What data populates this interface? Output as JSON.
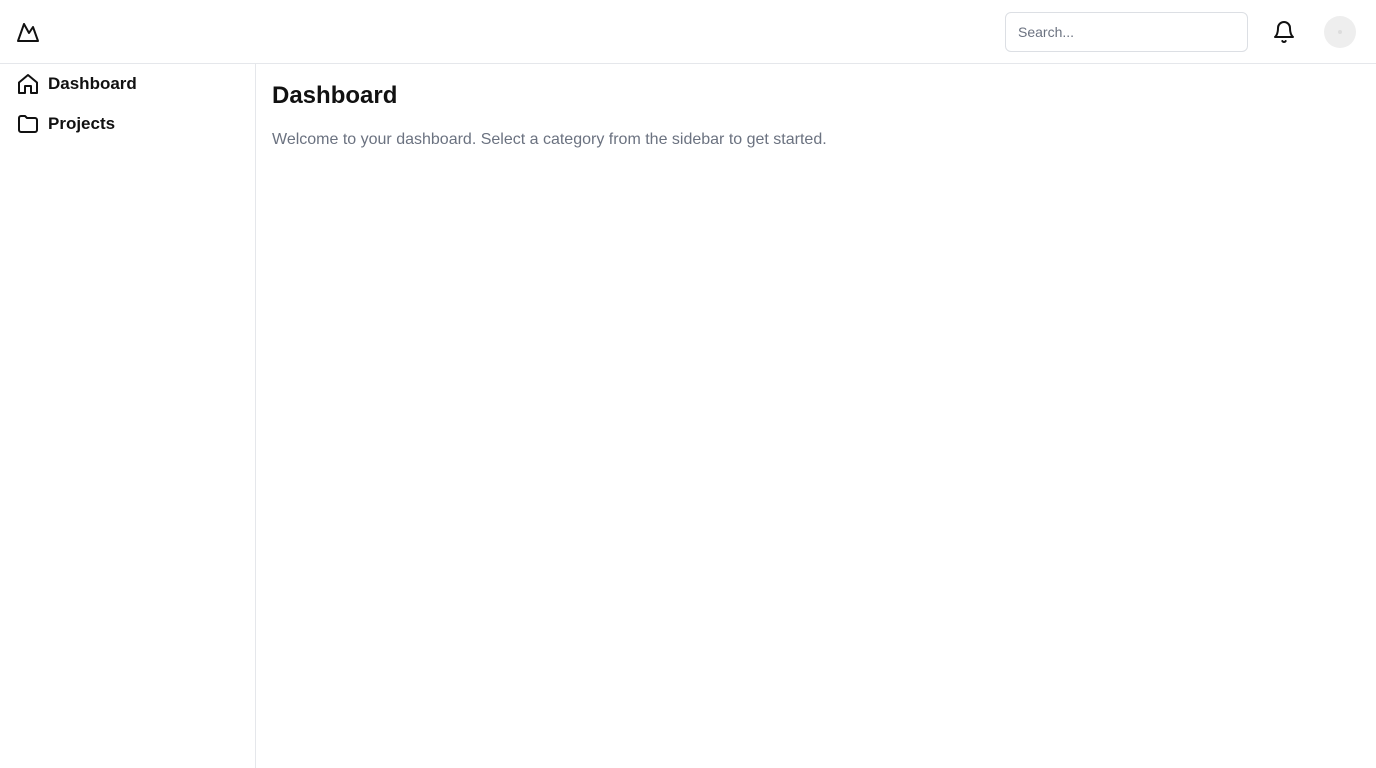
{
  "header": {
    "logo_icon": "mountain-logo-icon",
    "search": {
      "placeholder": "Search...",
      "value": ""
    },
    "notifications_icon": "bell-icon",
    "avatar_icon": "user-avatar"
  },
  "sidebar": {
    "items": [
      {
        "label": "Dashboard",
        "icon": "home-icon"
      },
      {
        "label": "Projects",
        "icon": "folder-icon"
      }
    ]
  },
  "main": {
    "title": "Dashboard",
    "subtitle": "Welcome to your dashboard. Select a category from the sidebar to get started."
  },
  "colors": {
    "border": "#e5e7eb",
    "text_primary": "#111111",
    "text_muted": "#6b7280",
    "avatar_bg": "#eeeeee"
  }
}
